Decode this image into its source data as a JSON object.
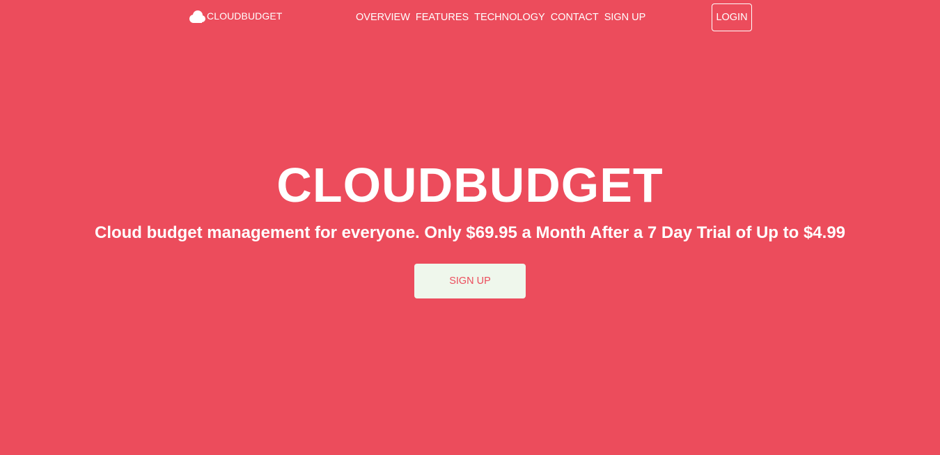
{
  "colors": {
    "background": "#ec4c5c",
    "text": "#ffffff",
    "cta_background": "#eff7ec",
    "cta_text": "#ec4c5c"
  },
  "navbar": {
    "brand": {
      "icon": "cloud-icon",
      "label": "CLOUDBUDGET"
    },
    "links": [
      {
        "label": "OVERVIEW"
      },
      {
        "label": "FEATURES"
      },
      {
        "label": "TECHNOLOGY"
      },
      {
        "label": "CONTACT"
      },
      {
        "label": "SIGN UP"
      }
    ],
    "login_label": "LOGIN"
  },
  "hero": {
    "title": "CLOUDBUDGET",
    "subtitle": "Cloud budget management for everyone. Only $69.95 a Month After a 7 Day Trial of Up to $4.99",
    "cta_label": "SIGN UP"
  }
}
